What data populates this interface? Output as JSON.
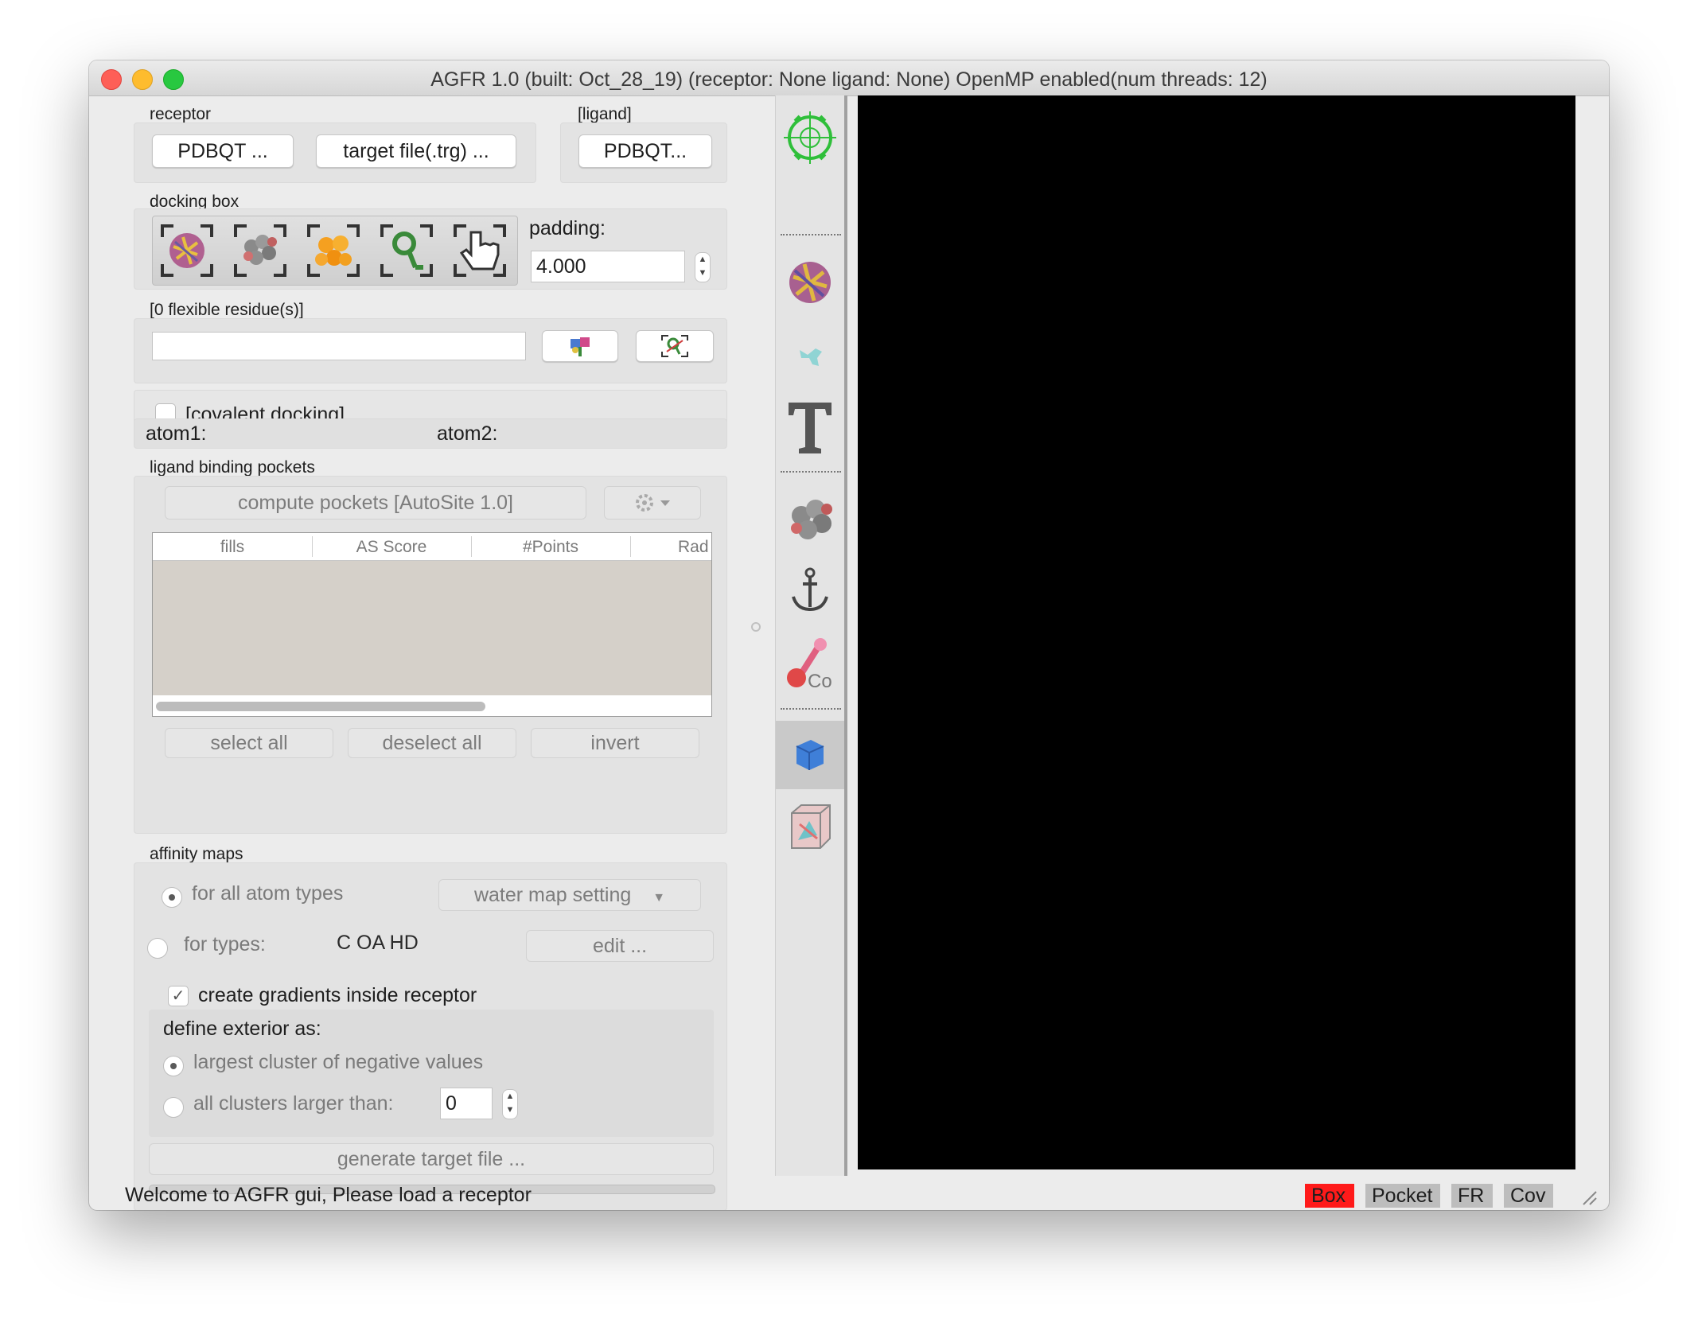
{
  "window": {
    "title": "AGFR 1.0 (built: Oct_28_19) (receptor: None ligand: None) OpenMP enabled(num threads: 12)"
  },
  "receptor": {
    "label": "receptor",
    "pdbqt_button": "PDBQT ...",
    "target_button": "target file(.trg) ..."
  },
  "ligand": {
    "label": "[ligand]",
    "pdbqt_button": "PDBQT..."
  },
  "docking_box": {
    "label": "docking box",
    "tools": [
      "receptor-box-icon",
      "ligand-box-icon",
      "pocket-box-icon",
      "residue-box-icon",
      "manual-box-icon"
    ],
    "padding_label": "padding:",
    "padding_value": "4.000"
  },
  "flexible": {
    "label": "[0 flexible residue(s)]",
    "input_value": ""
  },
  "covalent": {
    "label": "[covalent docking]",
    "atom1": "atom1:",
    "atom2": "atom2:"
  },
  "pockets": {
    "label": "ligand binding pockets",
    "compute_button": "compute pockets [AutoSite 1.0]",
    "columns": [
      "fills",
      "AS Score",
      "#Points",
      "Rad"
    ],
    "rows": [],
    "select_all": "select all",
    "deselect_all": "deselect all",
    "invert": "invert"
  },
  "affinity": {
    "label": "affinity maps",
    "all_types": "for all atom types",
    "water_map": "water map setting",
    "for_types": "for types:",
    "types_value": "C OA HD",
    "edit_button": "edit ...",
    "gradients": "create gradients inside receptor",
    "define_exterior": "define exterior as:",
    "largest_cluster": "largest cluster of negative values",
    "all_clusters": "all clusters larger than:",
    "cluster_value": "0",
    "generate_button": "generate target file ..."
  },
  "status": {
    "message": "Welcome to AGFR gui, Please load a receptor",
    "tags": [
      "Box",
      "Pocket",
      "FR",
      "Cov"
    ],
    "active_tag_color": "#ff0000"
  },
  "sidebar_tools": [
    "center-view-icon",
    "receptor-icon",
    "ligand-icon",
    "text-icon",
    "atoms-icon",
    "anchor-icon",
    "covalent-icon",
    "box-icon",
    "grid-icon"
  ]
}
